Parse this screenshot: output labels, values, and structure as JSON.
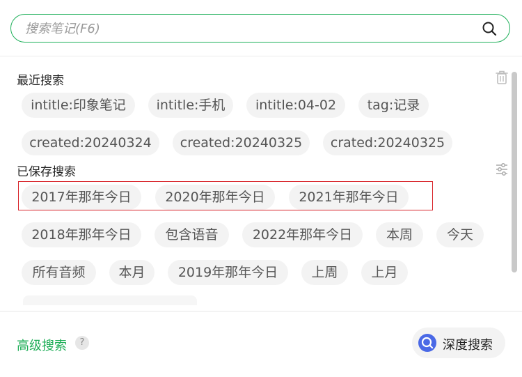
{
  "search": {
    "placeholder": "搜索笔记(F6)",
    "icon": "search-icon"
  },
  "recent": {
    "title": "最近搜索",
    "tags": [
      "intitle:印象笔记",
      "intitle:手机",
      "intitle:04-02",
      "tag:记录",
      "created:20240324",
      "created:20240325",
      "crated:20240325"
    ]
  },
  "saved": {
    "title": "已保存搜索",
    "tags": [
      "2017年那年今日",
      "2020年那年今日",
      "2021年那年今日",
      "2018年那年今日",
      "包含语音",
      "2022年那年今日",
      "本周",
      "今天",
      "所有音频",
      "本月",
      "2019年那年今日",
      "上周",
      "上月"
    ]
  },
  "footer": {
    "advanced": "高级搜索",
    "help": "?",
    "deep_search": "深度搜索"
  },
  "colors": {
    "accent": "#1fb05a",
    "highlight": "#d8252b",
    "deep_icon": "#4a69e6"
  }
}
